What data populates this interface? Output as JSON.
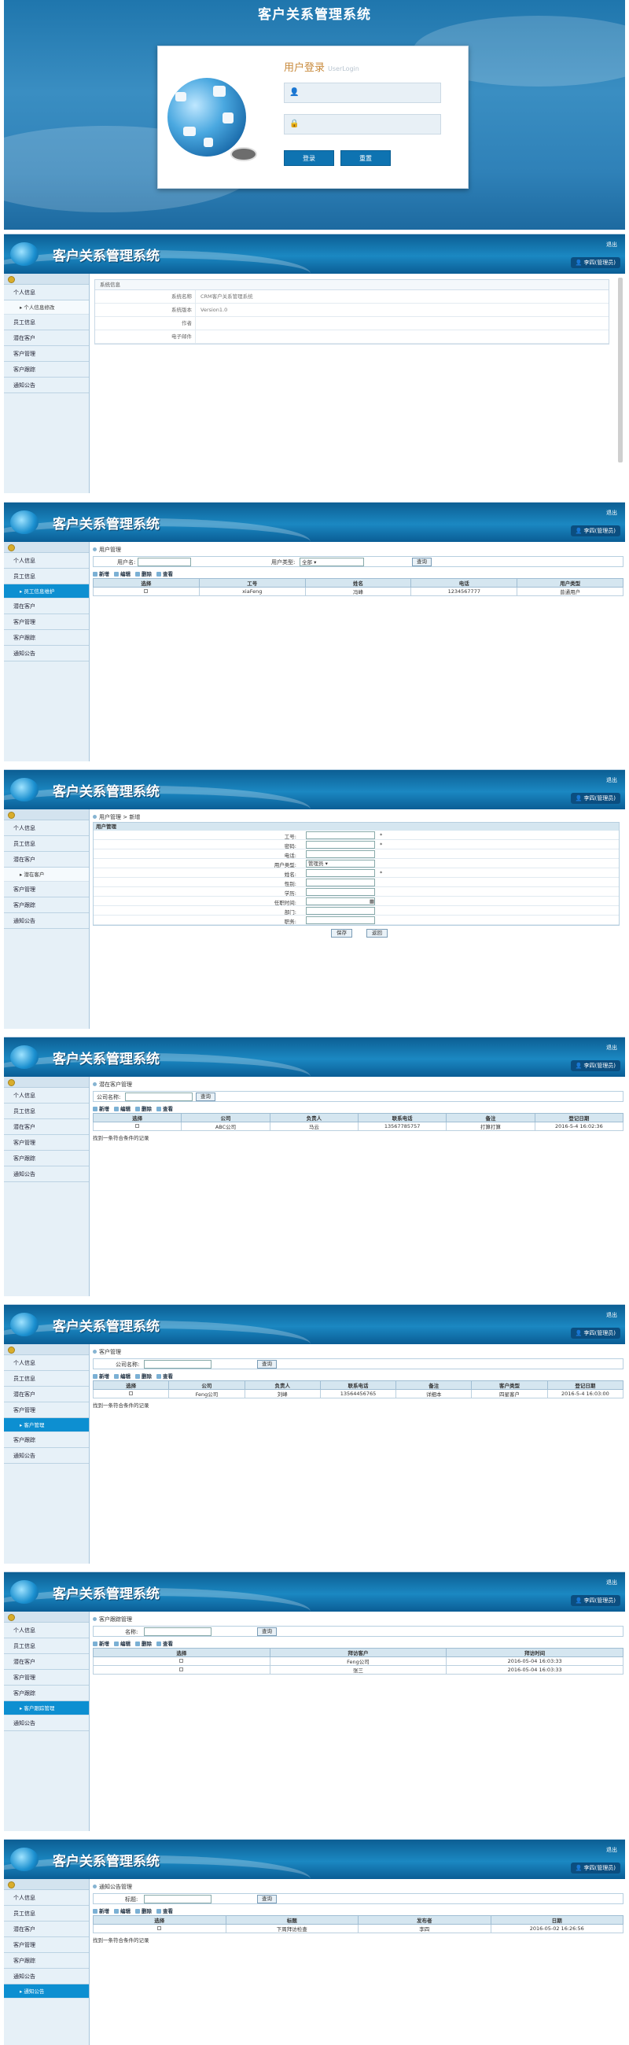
{
  "login": {
    "title": "客户关系管理系统",
    "heading": "用户登录",
    "heading_en": "UserLogin",
    "username_icon": "user-icon",
    "password_icon": "lock-icon",
    "login_button": "登录",
    "reset_button": "重置"
  },
  "app": {
    "title": "客户关系管理系统",
    "logout": "退出",
    "user": "李四(管理员)"
  },
  "menu": {
    "personal": "个人信息",
    "personal_sub": "个人信息修改",
    "staff": "员工信息",
    "staff_sub": "员工信息维护",
    "potential": "潜在客户",
    "potential_sub": "潜在客户",
    "customer": "客户管理",
    "customer_sub": "客户管理",
    "tracking": "客户跟踪",
    "tracking_sub": "客户跟踪管理",
    "notice": "通知公告",
    "notice_sub": "通知公告"
  },
  "screen1": {
    "header": "系统信息",
    "rows": [
      {
        "k": "系统名称",
        "v": "CRM客户关系管理系统"
      },
      {
        "k": "系统版本",
        "v": "Version1.0"
      },
      {
        "k": "作者",
        "v": ""
      },
      {
        "k": "电子邮件",
        "v": ""
      }
    ]
  },
  "screen2": {
    "crumb": "用户管理",
    "search_label": "用户名:",
    "type_label": "用户类型:",
    "type_value": "全部",
    "search_button": "查询",
    "toolbar": [
      "新增",
      "编辑",
      "删除",
      "查看"
    ],
    "headers": [
      "选择",
      "工号",
      "姓名",
      "电话",
      "用户类型"
    ],
    "rows": [
      [
        "",
        "xiaFeng",
        "冯峰",
        "1234567777",
        "普通用户"
      ]
    ]
  },
  "screen3": {
    "crumb": "用户管理 > 新增",
    "form_title": "用户管理",
    "fields": [
      {
        "label": "工号:",
        "value": "",
        "required": "*"
      },
      {
        "label": "密码:",
        "value": "",
        "required": "*"
      },
      {
        "label": "电话:",
        "value": "",
        "required": ""
      },
      {
        "label": "用户类型:",
        "value": "管理员",
        "required": ""
      },
      {
        "label": "姓名:",
        "value": "",
        "required": "*"
      },
      {
        "label": "性别:",
        "value": "",
        "required": ""
      },
      {
        "label": "学历:",
        "value": "",
        "required": ""
      },
      {
        "label": "任职时间:",
        "value": "",
        "required": ""
      },
      {
        "label": "部门:",
        "value": "",
        "required": ""
      },
      {
        "label": "职务:",
        "value": "",
        "required": ""
      }
    ],
    "save": "保存",
    "back": "返回"
  },
  "screen4": {
    "crumb": "潜在客户管理",
    "search_label": "公司名称:",
    "search_button": "查询",
    "toolbar": [
      "新增",
      "编辑",
      "删除",
      "查看"
    ],
    "headers": [
      "选择",
      "公司",
      "负责人",
      "联系电话",
      "备注",
      "登记日期"
    ],
    "rows": [
      [
        "",
        "ABC公司",
        "马云",
        "13567785757",
        "打算打算",
        "2016-5-4 16:02:36"
      ]
    ],
    "message": "找到一条符合条件的记录"
  },
  "screen5": {
    "crumb": "客户管理",
    "search_label": "公司名称:",
    "search_button": "查询",
    "toolbar": [
      "新增",
      "编辑",
      "删除",
      "查看"
    ],
    "headers": [
      "选择",
      "公司",
      "负责人",
      "联系电话",
      "备注",
      "客户类型",
      "登记日期"
    ],
    "rows": [
      [
        "",
        "Feng公司",
        "刘峰",
        "13564456765",
        "详细本",
        "四星客户",
        "2016-5-4 16:03:00"
      ]
    ],
    "message": "找到一条符合条件的记录"
  },
  "screen6": {
    "crumb": "客户跟踪管理",
    "search_label": "名称:",
    "search_button": "查询",
    "toolbar": [
      "新增",
      "编辑",
      "删除",
      "查看"
    ],
    "headers": [
      "选择",
      "拜访客户",
      "拜访时间"
    ],
    "rows": [
      [
        "",
        "Feng公司",
        "2016-05-04 16:03:33"
      ],
      [
        "",
        "张三",
        "2016-05-04 16:03:33"
      ]
    ]
  },
  "screen7": {
    "crumb": "通知公告管理",
    "search_label": "标题:",
    "search_button": "查询",
    "toolbar": [
      "新增",
      "编辑",
      "删除",
      "查看"
    ],
    "headers": [
      "选择",
      "标题",
      "发布者",
      "日期"
    ],
    "rows": [
      [
        "",
        "下周拜访检查",
        "李四",
        "2016-05-02 16:26:56"
      ]
    ],
    "message": "找到一条符合条件的记录"
  }
}
